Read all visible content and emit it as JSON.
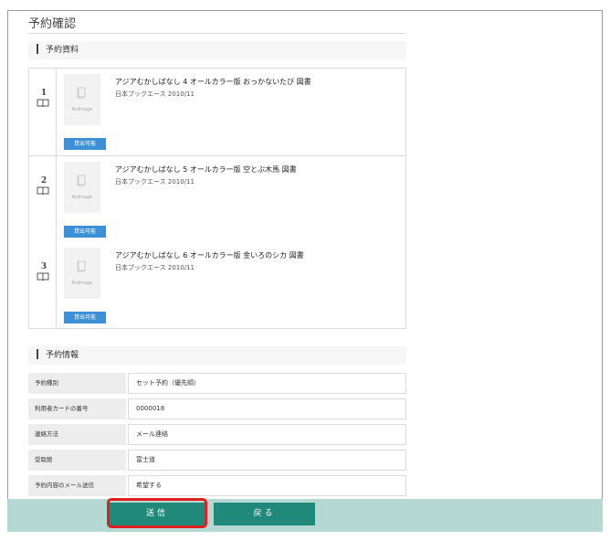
{
  "page_title": "予約確認",
  "section_materials": "予約資料",
  "section_info": "予約情報",
  "items": [
    {
      "num": "1",
      "title": "アジアむかしばなし 4 オールカラー版 おっかないたび 図書",
      "publisher": "日本ブックエース 2010/11",
      "status": "貸出可能",
      "noimage": "NoImage"
    },
    {
      "num": "2",
      "title": "アジアむかしばなし 5 オールカラー版 空とぶ木馬 図書",
      "publisher": "日本ブックエース 2010/11",
      "status": "貸出可能",
      "noimage": "NoImage"
    },
    {
      "num": "3",
      "title": "アジアむかしばなし 6 オールカラー版 金いろのシカ 図書",
      "publisher": "日本ブックエース 2010/11",
      "status": "貸出可能",
      "noimage": "NoImage"
    }
  ],
  "form": [
    {
      "label": "予約種別",
      "value": "セット予約（優先順）"
    },
    {
      "label": "利用者カードの番号",
      "value": "0000018"
    },
    {
      "label": "連絡方法",
      "value": "メール連絡"
    },
    {
      "label": "受取館",
      "value": "富士道"
    },
    {
      "label": "予約内容のメール送信",
      "value": "希望する"
    }
  ],
  "buttons": {
    "send": "送信",
    "back": "戻る"
  },
  "icons": {
    "book": "book-open-icon",
    "placeholder": "book-placeholder-icon"
  },
  "colors": {
    "badge": "#3d8fd6",
    "button": "#21897a",
    "footer": "#b6d8d2",
    "highlight": "#e02020"
  }
}
